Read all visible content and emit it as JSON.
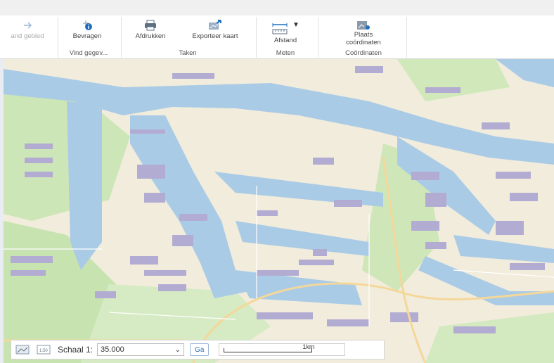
{
  "ribbon": {
    "groups": [
      {
        "label": "Vind gegev..."
      },
      {
        "label": "Taken"
      },
      {
        "label": "Meten"
      },
      {
        "label": "Coördinaten"
      }
    ],
    "tools": {
      "zoom_area": "and gebied",
      "query": "Bevragen",
      "print": "Afdrukken",
      "export_map": "Exporteer kaart",
      "distance": "Afstand",
      "place_coords_1": "Plaats",
      "place_coords_2": "coördinaten"
    }
  },
  "scalebar": {
    "scale_label": "Schaal 1:",
    "scale_value": "35.000",
    "go_label": "Ga",
    "ruler_label": "1km"
  },
  "colors": {
    "water": "#aacbe6",
    "land": "#f3ecdc",
    "green": "#c9e6b4",
    "building": "#b3acd2",
    "road": "#f7d79b"
  }
}
